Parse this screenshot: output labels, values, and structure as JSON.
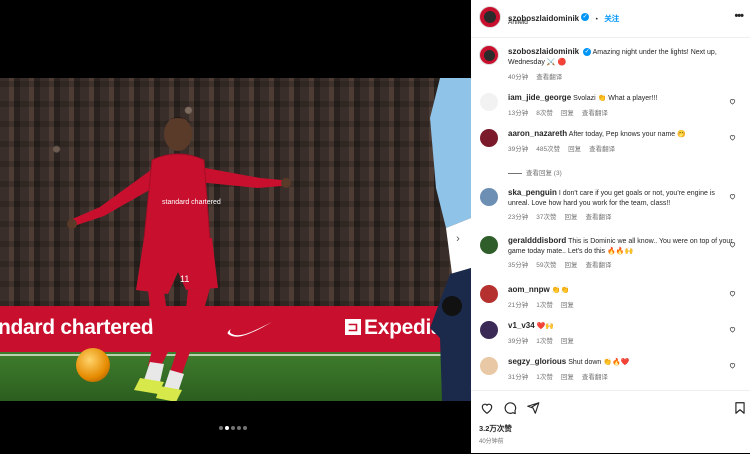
{
  "post": {
    "username": "szoboszlaidominik",
    "separator": "•",
    "follow_label": "关注",
    "location": "Anfield",
    "caption_user": "szoboszlaidominik",
    "caption_text": "Amazing night under the lights! Next up, Wednesday",
    "caption_emoji": "⚔️ 🔴",
    "caption_time": "40分钟",
    "see_translation": "查看翻译",
    "likes": "3.2万次赞",
    "time_ago": "40分钟前"
  },
  "media": {
    "board_text_left": "ndard chartered",
    "board_text_right": "Expedia",
    "kit_sponsor": "standard chartered",
    "shirt_number": "11",
    "slides_count": 5,
    "active_slide": 2
  },
  "comments": [
    {
      "user": "iam_jide_george",
      "text": "Svolazi",
      "emoji": "👏 What a player!!!",
      "time": "13分钟",
      "likes": "8次赞",
      "reply": "回复",
      "translate": "查看翻译",
      "avatar_color": "#f2f2f2"
    },
    {
      "user": "aaron_nazareth",
      "text": "After today, Pep knows your name",
      "emoji": "🤭",
      "time": "39分钟",
      "likes": "485次赞",
      "reply": "回复",
      "translate": "查看翻译",
      "avatar_color": "#7a1a2b"
    },
    {
      "user": "ska_penguin",
      "text": "I don't care if you get goals or not, you're engine is unreal. Love how hard you work for the team, class!!",
      "emoji": "",
      "time": "23分钟",
      "likes": "37次赞",
      "reply": "回复",
      "translate": "查看翻译",
      "avatar_color": "#6c8fb3"
    },
    {
      "user": "geraldddisbord",
      "text": "This is Dominic we all know.. You were on top of your game today mate.. Let's do this",
      "emoji": "🔥🔥🙌",
      "time": "35分钟",
      "likes": "59次赞",
      "reply": "回复",
      "translate": "查看翻译",
      "avatar_color": "#2f5e2a"
    },
    {
      "user": "aom_nnpw",
      "text": "",
      "emoji": "👏👏",
      "time": "21分钟",
      "likes": "1次赞",
      "reply": "回复",
      "translate": "",
      "avatar_color": "#b5312f"
    },
    {
      "user": "v1_v34",
      "text": "",
      "emoji": "❤️🙌",
      "time": "39分钟",
      "likes": "1次赞",
      "reply": "回复",
      "translate": "",
      "avatar_color": "#3a2a55"
    },
    {
      "user": "segzy_glorious",
      "text": "Shut down",
      "emoji": "👏🔥❤️",
      "time": "31分钟",
      "likes": "1次赞",
      "reply": "回复",
      "translate": "查看翻译",
      "avatar_color": "#e9c8a5"
    }
  ],
  "view_replies": "查看回复 (3)",
  "icons": {
    "like": "heart-icon",
    "comment": "comment-icon",
    "share": "share-icon",
    "save": "bookmark-icon",
    "more": "more-icon",
    "next": "chevron-right-icon"
  },
  "colors": {
    "accent": "#0095f6",
    "liverpool_red": "#c8102e",
    "text": "#262626",
    "muted": "#737373"
  }
}
